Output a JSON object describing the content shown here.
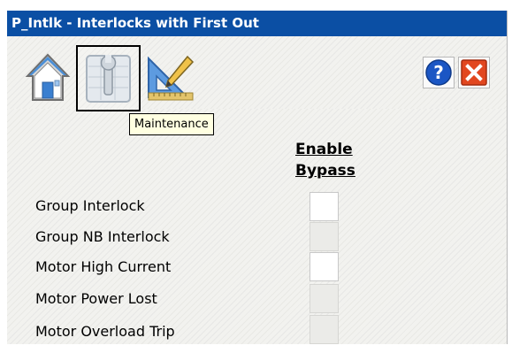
{
  "window": {
    "title": "P_Intlk - Interlocks with First Out"
  },
  "toolbar": {
    "home_icon": "home-icon",
    "maintenance_icon": "maintenance-icon",
    "engineering_icon": "engineering-icon",
    "help_icon": "help-icon",
    "close_icon": "close-icon",
    "tooltip": "Maintenance"
  },
  "table": {
    "header_line1": "Enable",
    "header_line2": "Bypass",
    "rows": [
      {
        "label": "Group Interlock",
        "enabled": true
      },
      {
        "label": "Group NB Interlock",
        "enabled": false
      },
      {
        "label": "Motor High Current",
        "enabled": true
      },
      {
        "label": "Motor Power Lost",
        "enabled": false
      },
      {
        "label": "Motor Overload Trip",
        "enabled": false
      }
    ]
  },
  "colors": {
    "title_bar": "#0b4fa4",
    "help_blue": "#1b56c4",
    "close_red": "#e2471f"
  }
}
